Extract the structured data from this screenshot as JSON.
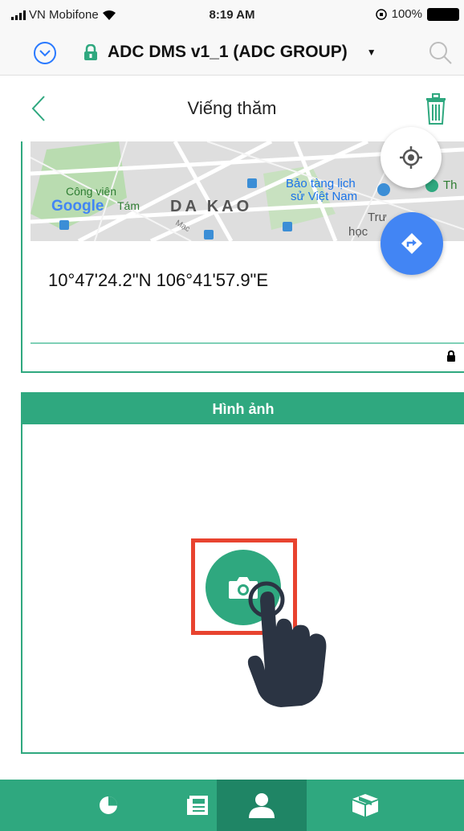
{
  "status_bar": {
    "carrier": "VN Mobifone",
    "time": "8:19 AM",
    "battery": "100%"
  },
  "app_bar": {
    "title": "ADC DMS v1_1 (ADC GROUP)"
  },
  "nav": {
    "title": "Viếng thăm"
  },
  "map": {
    "labels": {
      "cong_vien": "Công viên",
      "google": "Google",
      "tam": "Tám",
      "district": "DA KAO",
      "museum_line1": "Bảo tàng lịch",
      "museum_line2": "sử Việt Nam",
      "th": "Th",
      "truong": "Trư",
      "hoc": "học",
      "mac": "Mạc"
    },
    "coordinates": "10°47'24.2\"N 106°41'57.9\"E"
  },
  "image_section": {
    "title": "Hình ảnh"
  },
  "bottom_nav": {
    "tabs": [
      {
        "icon": "pie-chart-icon",
        "active": false
      },
      {
        "icon": "newspaper-icon",
        "active": false
      },
      {
        "icon": "user-icon",
        "active": true
      },
      {
        "icon": "box-icon",
        "active": false
      }
    ]
  },
  "colors": {
    "primary": "#2fa87f",
    "primary_dark": "#1f8565",
    "highlight": "#e8432f",
    "link_blue": "#2979ff",
    "map_fab": "#4285f4"
  }
}
